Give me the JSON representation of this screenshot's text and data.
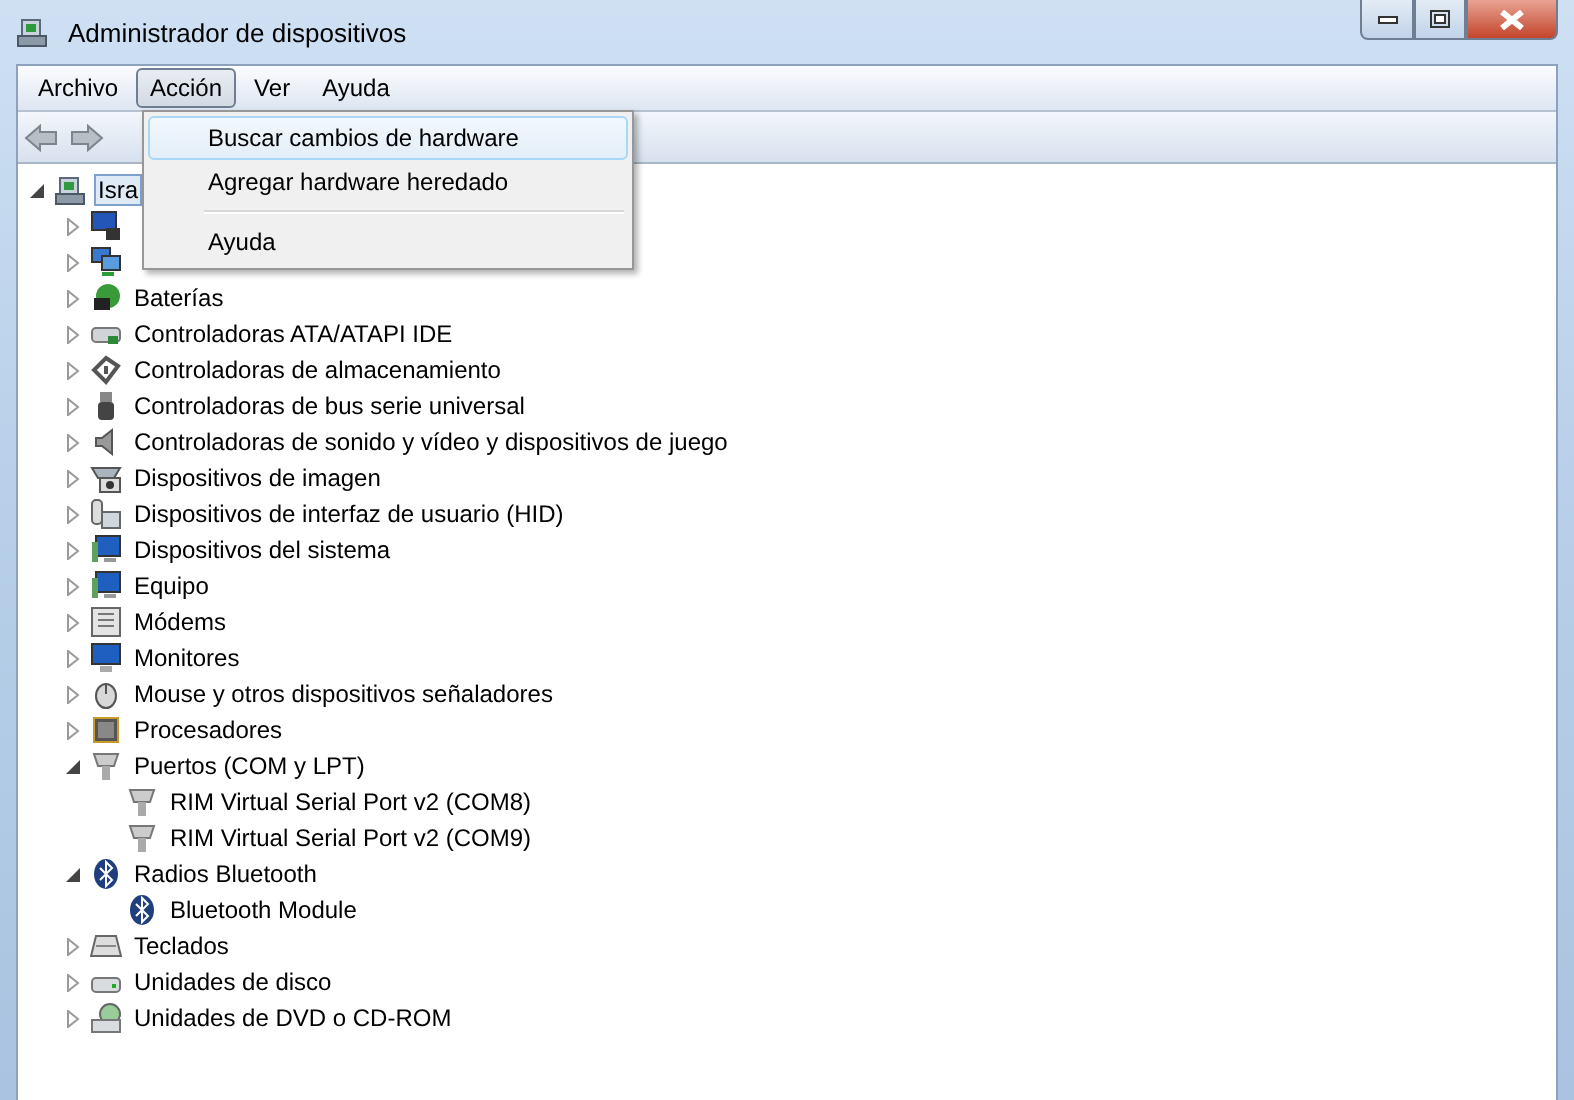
{
  "window": {
    "title": "Administrador de dispositivos"
  },
  "menu_bar": [
    {
      "label": "Archivo",
      "selected": false
    },
    {
      "label": "Acción",
      "selected": true
    },
    {
      "label": "Ver",
      "selected": false
    },
    {
      "label": "Ayuda",
      "selected": false
    }
  ],
  "dropdown_menu": [
    {
      "label": "Buscar cambios de hardware",
      "selected": true
    },
    {
      "label": "Agregar hardware heredado",
      "selected": false
    },
    {
      "kind": "separator"
    },
    {
      "label": "Ayuda",
      "selected": false
    }
  ],
  "tree": {
    "label": "Isra",
    "selected": true,
    "expanded": true,
    "children": [
      {
        "expanded": false
      },
      {
        "expanded": false
      },
      {
        "label": "Baterías",
        "selected": false,
        "expanded": false
      },
      {
        "label": "Controladoras ATA/ATAPI IDE",
        "selected": false,
        "expanded": false
      },
      {
        "label": "Controladoras de almacenamiento",
        "selected": false,
        "expanded": false
      },
      {
        "label": "Controladoras de bus serie universal",
        "selected": false,
        "expanded": false
      },
      {
        "label": "Controladoras de sonido y vídeo y dispositivos de juego",
        "selected": false,
        "expanded": false
      },
      {
        "label": "Dispositivos de imagen",
        "selected": false,
        "expanded": false
      },
      {
        "label": "Dispositivos de interfaz de usuario (HID)",
        "selected": false,
        "expanded": false
      },
      {
        "label": "Dispositivos del sistema",
        "selected": false,
        "expanded": false
      },
      {
        "label": "Equipo",
        "selected": false,
        "expanded": false
      },
      {
        "label": "Módems",
        "selected": false,
        "expanded": false
      },
      {
        "label": "Monitores",
        "selected": false,
        "expanded": false
      },
      {
        "label": "Mouse y otros dispositivos señaladores",
        "selected": false,
        "expanded": false
      },
      {
        "label": "Procesadores",
        "selected": false,
        "expanded": false
      },
      {
        "label": "Puertos (COM y LPT)",
        "selected": false,
        "expanded": true,
        "children": [
          {
            "label": "RIM Virtual Serial Port v2 (COM8)",
            "selected": false
          },
          {
            "label": "RIM Virtual Serial Port v2 (COM9)",
            "selected": false
          }
        ]
      },
      {
        "label": "Radios Bluetooth",
        "selected": false,
        "expanded": true,
        "children": [
          {
            "label": "Bluetooth Module",
            "selected": false
          }
        ]
      },
      {
        "label": "Teclados",
        "selected": false,
        "expanded": false
      },
      {
        "label": "Unidades de disco",
        "selected": false,
        "expanded": false
      },
      {
        "label": "Unidades de DVD o CD-ROM",
        "selected": false,
        "expanded": false
      }
    ]
  }
}
